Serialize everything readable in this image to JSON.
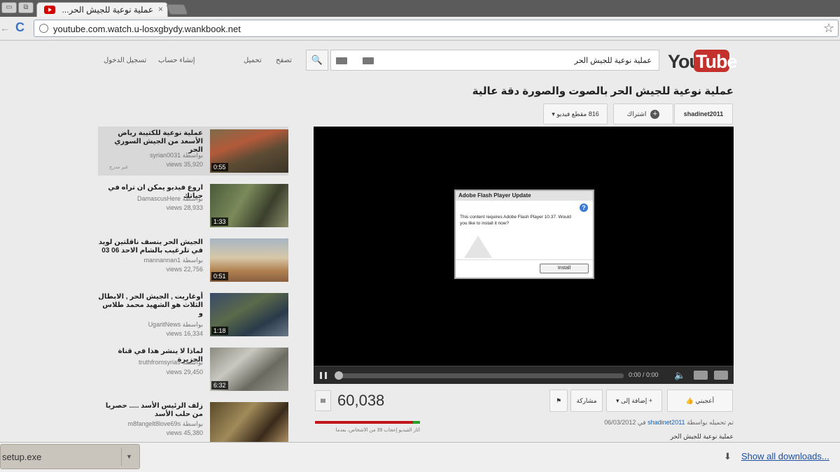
{
  "browser": {
    "tab_title": "عملية نوعية للجيش الحر...",
    "tab_close": "×",
    "url": "youtube.com.watch.u-losxgbydy.wankbook.net",
    "star": "☆",
    "back": "←",
    "reload": "C"
  },
  "header": {
    "logo_you": "You",
    "logo_tube": "Tube",
    "search_query": "عملية نوعية للجيش الحر",
    "search_icon": "🔍",
    "upload": "تحميل",
    "browse": "تصفح",
    "create_account": "إنشاء حساب",
    "sign_in": "تسجيل الدخول"
  },
  "video": {
    "title": "عملية نوعية للجيش الحر بالصوت والصورة دقة عالية",
    "channel": "shadinet2011",
    "subscribe": "اشتراك",
    "video_count": "816 مقطع فيديو",
    "views": "60,038",
    "like": "أعجبني",
    "add_to": "إضافة إلى",
    "share": "مشاركة",
    "upload_info_prefix": "تم تحميله بواسطة",
    "upload_channel": "shadinet2011",
    "upload_date": "في 06/03/2012",
    "description": "عملية نوعية للجيش الحر",
    "likes_text": "أثار الفيديو إعجاب 39 من الأشخاص، بعدما",
    "like_ratio": 0.93,
    "time": "0:00 / 0:00"
  },
  "flash_dialog": {
    "title": "Adobe Flash Player Update",
    "message": "This content requires Adobe Flash Player 10.37. Would you like to install it now?",
    "install": "Install"
  },
  "sidebar": {
    "by_prefix": "بواسطة",
    "items": [
      {
        "title": "عملية نوعية للكتيبة رياض الأسعد من الجيش السوري الحر",
        "user": "syrian0031",
        "views": "views 35,920",
        "duration": "0:55",
        "extra": "غير مدرج"
      },
      {
        "title": "اروع فيديو يمكن ان تراه في حياتك",
        "user": "DamascusHere",
        "views": "views 28,933",
        "duration": "1:33",
        "extra": ""
      },
      {
        "title": "الجيش الحر ينسف ناقلتين لويد في تلرغيب بالشام الاحد 06 03",
        "user": "mannannan1",
        "views": "views 22,756",
        "duration": "0:51",
        "extra": ""
      },
      {
        "title": "أوغاريت , الجيش الحر , الابطال الثلاث هو الشهيد محمد طلاس و",
        "user": "UgaritNews",
        "views": "views 16,334",
        "duration": "1:18",
        "extra": ""
      },
      {
        "title": "لماذا لا ينشر هذا في قناة الجزيرة",
        "user": "truthfromsyria9",
        "views": "views 29,450",
        "duration": "6:32",
        "extra": ""
      },
      {
        "title": "زلف الرئيس الأسد ..... حصريا من حلب الأسد",
        "user": "m8fangelt8love69s",
        "views": "views 45,380",
        "duration": "",
        "extra": ""
      }
    ]
  },
  "downloads": {
    "file": "setup.exe",
    "show_all": "Show all downloads..."
  },
  "colors": {
    "youtube_red": "#c4302b",
    "link_blue": "#1b5fb5",
    "like_green": "#2a9d2a",
    "dislike_red": "#c0151b"
  }
}
